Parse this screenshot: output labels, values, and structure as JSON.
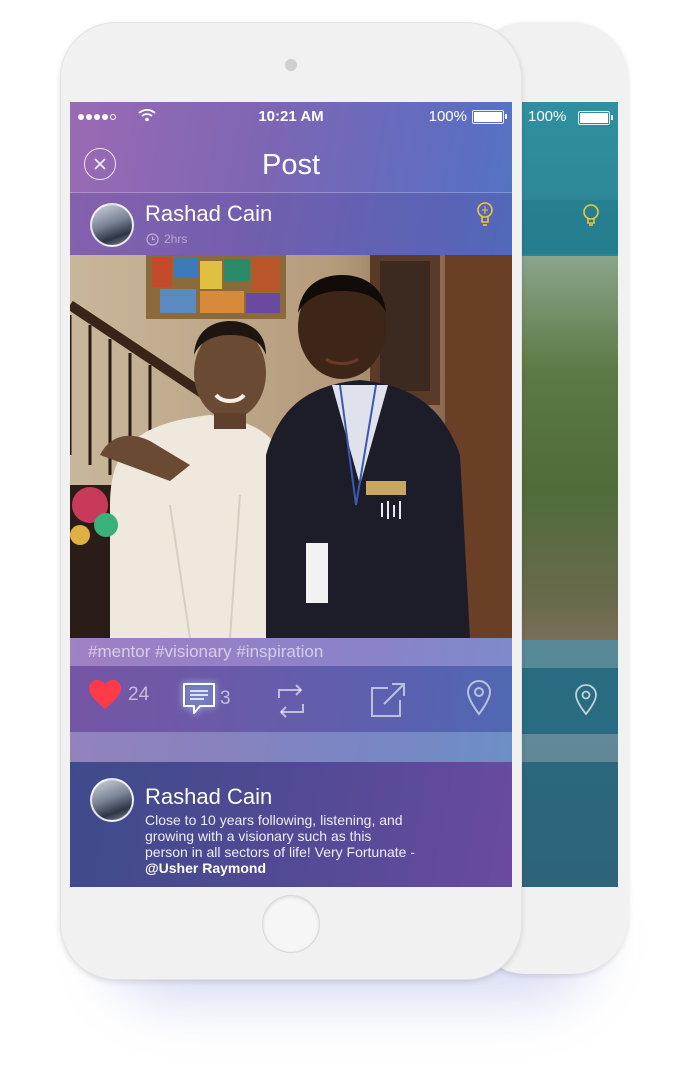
{
  "back_screen": {
    "battery_text": "100%"
  },
  "status_bar": {
    "time": "10:21 AM",
    "battery_text": "100%"
  },
  "nav": {
    "title": "Post"
  },
  "post": {
    "author": "Rashad Cain",
    "time_ago": "2hrs",
    "tags": "#mentor #visionary #inspiration"
  },
  "actions": {
    "likes": "24",
    "comments": "3"
  },
  "comment": {
    "author": "Rashad Cain",
    "text": "Close to 10 years following, listening, and growing with a visionary such as this person in all sectors of life! Very Fortunate - ",
    "mention": "@Usher Raymond"
  },
  "colors": {
    "like_heart": "#ff3b4a",
    "bulb": "#f0c63a"
  },
  "icons": [
    "close-icon",
    "clock-icon",
    "lightbulb-icon",
    "heart-icon",
    "comment-icon",
    "repost-icon",
    "share-icon",
    "location-icon"
  ]
}
